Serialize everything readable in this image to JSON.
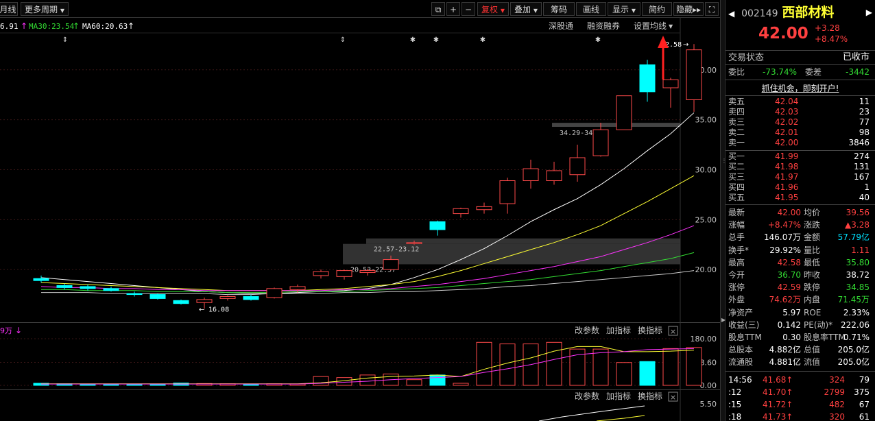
{
  "toolbar": {
    "left_tabs": [
      "月线",
      "更多周期"
    ],
    "right_buttons": [
      "复权",
      "叠加",
      "筹码",
      "画线",
      "显示",
      "简约",
      "隐藏"
    ],
    "icons": [
      "square-icon",
      "plus-icon",
      "minus-icon",
      "double-right-icon",
      "fullscreen-icon"
    ]
  },
  "ma_legend": {
    "ma_prev": "6.91",
    "ma30": "MA30:23.54",
    "ma60": "MA60:20.63"
  },
  "chart_links": {
    "shenguo": "深股通",
    "rongzi": "融资融券",
    "settings": "设置均线"
  },
  "annotations": {
    "high_label": "42.58",
    "low_label": "16.08",
    "zone1": "34.29-34.69",
    "zone2": "22.57-23.12",
    "zone3": "20.53-22.57"
  },
  "y_axis_ticks": [
    "40.00",
    "35.00",
    "30.00",
    "25.00",
    "20.00"
  ],
  "sub_panel": {
    "label": "9万",
    "buttons": [
      "改参数",
      "加指标",
      "换指标"
    ],
    "ticks": [
      "180.00",
      "88.60",
      "0.00"
    ]
  },
  "ind_panel": {
    "buttons": [
      "改参数",
      "加指标",
      "换指标"
    ],
    "ticks": [
      "5.50"
    ]
  },
  "chart_data": {
    "type": "candlestick",
    "ylim": [
      15,
      42.8
    ],
    "candles": [
      {
        "o": 19.1,
        "h": 19.4,
        "l": 18.7,
        "c": 18.9
      },
      {
        "o": 18.4,
        "h": 18.6,
        "l": 18.0,
        "c": 18.2
      },
      {
        "o": 18.3,
        "h": 18.5,
        "l": 17.9,
        "c": 18.1
      },
      {
        "o": 18.1,
        "h": 18.3,
        "l": 17.8,
        "c": 17.9
      },
      {
        "o": 17.6,
        "h": 17.8,
        "l": 17.3,
        "c": 17.5
      },
      {
        "o": 17.5,
        "h": 17.6,
        "l": 17.0,
        "c": 17.1
      },
      {
        "o": 16.9,
        "h": 17.0,
        "l": 16.5,
        "c": 16.6
      },
      {
        "o": 16.7,
        "h": 17.2,
        "l": 16.08,
        "c": 17.0
      },
      {
        "o": 17.1,
        "h": 17.4,
        "l": 16.9,
        "c": 17.3
      },
      {
        "o": 17.3,
        "h": 17.5,
        "l": 16.9,
        "c": 17.0
      },
      {
        "o": 17.2,
        "h": 18.2,
        "l": 17.1,
        "c": 18.1
      },
      {
        "o": 18.0,
        "h": 18.5,
        "l": 17.7,
        "c": 18.3
      },
      {
        "o": 19.4,
        "h": 20.0,
        "l": 19.1,
        "c": 19.8
      },
      {
        "o": 19.3,
        "h": 20.0,
        "l": 19.0,
        "c": 19.9
      },
      {
        "o": 19.7,
        "h": 20.1,
        "l": 19.4,
        "c": 19.9
      },
      {
        "o": 20.0,
        "h": 21.4,
        "l": 19.9,
        "c": 21.0
      },
      {
        "o": 22.6,
        "h": 22.9,
        "l": 22.5,
        "c": 22.7
      },
      {
        "o": 24.8,
        "h": 24.9,
        "l": 23.4,
        "c": 24.0
      },
      {
        "o": 25.6,
        "h": 26.2,
        "l": 25.2,
        "c": 26.1
      },
      {
        "o": 26.0,
        "h": 26.7,
        "l": 25.6,
        "c": 26.3
      },
      {
        "o": 26.6,
        "h": 29.2,
        "l": 25.6,
        "c": 28.9
      },
      {
        "o": 28.9,
        "h": 31.0,
        "l": 28.1,
        "c": 30.1
      },
      {
        "o": 28.9,
        "h": 30.8,
        "l": 28.5,
        "c": 29.9
      },
      {
        "o": 29.5,
        "h": 32.5,
        "l": 28.8,
        "c": 31.2
      },
      {
        "o": 31.4,
        "h": 34.7,
        "l": 31.3,
        "c": 34.0
      },
      {
        "o": 34.0,
        "h": 37.4,
        "l": 34.0,
        "c": 37.4
      },
      {
        "o": 40.5,
        "h": 41.0,
        "l": 36.8,
        "c": 37.8
      },
      {
        "o": 38.2,
        "h": 39.2,
        "l": 36.2,
        "c": 39.0
      },
      {
        "o": 37.0,
        "h": 42.58,
        "l": 35.8,
        "c": 42.0
      }
    ],
    "ma_lines": [
      {
        "name": "MA-white",
        "color": "#ffffff",
        "values": [
          19.2,
          19.0,
          18.8,
          18.6,
          18.4,
          18.2,
          18.0,
          17.8,
          17.7,
          17.6,
          17.6,
          17.7,
          17.8,
          17.9,
          18.1,
          18.5,
          19.2,
          20.0,
          21.0,
          22.1,
          23.4,
          24.8,
          26.0,
          27.1,
          28.5,
          30.1,
          31.9,
          33.6,
          35.7
        ]
      },
      {
        "name": "MA-yellow",
        "color": "#ffff33",
        "values": [
          18.7,
          18.6,
          18.5,
          18.4,
          18.3,
          18.2,
          18.1,
          18.0,
          17.9,
          17.9,
          17.9,
          17.9,
          18.0,
          18.1,
          18.3,
          18.5,
          18.8,
          19.3,
          19.9,
          20.6,
          21.3,
          22.0,
          22.7,
          23.5,
          24.4,
          25.6,
          26.8,
          28.1,
          29.4
        ]
      },
      {
        "name": "MA-magenta",
        "color": "#ff33ff",
        "values": [
          18.3,
          18.2,
          18.2,
          18.1,
          18.1,
          18.0,
          18.0,
          17.9,
          17.9,
          17.9,
          17.9,
          17.9,
          17.9,
          18.0,
          18.0,
          18.1,
          18.3,
          18.5,
          18.8,
          19.1,
          19.5,
          19.9,
          20.3,
          20.8,
          21.3,
          22.0,
          22.7,
          23.5,
          24.4
        ]
      },
      {
        "name": "MA30",
        "color": "#33dd33",
        "values": [
          18.0,
          18.0,
          17.9,
          17.9,
          17.9,
          17.8,
          17.8,
          17.8,
          17.7,
          17.7,
          17.7,
          17.8,
          17.8,
          17.8,
          17.9,
          18.0,
          18.1,
          18.2,
          18.4,
          18.6,
          18.8,
          19.0,
          19.3,
          19.6,
          19.9,
          20.3,
          20.7,
          21.1,
          21.7
        ]
      },
      {
        "name": "MA60",
        "color": "#cccccc",
        "values": [
          17.7,
          17.7,
          17.7,
          17.6,
          17.6,
          17.6,
          17.6,
          17.6,
          17.5,
          17.5,
          17.6,
          17.6,
          17.6,
          17.7,
          17.7,
          17.8,
          17.8,
          17.9,
          18.0,
          18.1,
          18.3,
          18.4,
          18.6,
          18.8,
          19.0,
          19.2,
          19.4,
          19.6,
          19.9
        ]
      }
    ],
    "zones": [
      {
        "low": 34.29,
        "high": 34.69
      },
      {
        "low": 22.57,
        "high": 23.12
      },
      {
        "low": 20.53,
        "high": 22.57
      }
    ],
    "volume": {
      "ylim": [
        0,
        180
      ],
      "values": [
        8,
        6,
        5,
        5,
        4,
        5,
        9,
        7,
        6,
        5,
        6,
        5,
        34,
        30,
        40,
        44,
        22,
        40,
        8,
        166,
        160,
        160,
        166,
        140,
        140,
        88,
        92,
        142,
        146
      ],
      "ma_a": [
        6,
        6,
        6,
        6,
        6,
        6,
        6,
        6,
        6,
        6,
        6,
        6,
        10,
        18,
        28,
        34,
        36,
        40,
        34,
        62,
        86,
        106,
        132,
        150,
        150,
        130,
        130,
        132,
        136
      ],
      "ma_b": [
        5,
        5,
        5,
        5,
        5,
        5,
        5,
        5,
        5,
        5,
        5,
        5,
        8,
        12,
        16,
        22,
        26,
        30,
        34,
        50,
        64,
        80,
        100,
        118,
        126,
        130,
        138,
        140,
        142
      ]
    }
  },
  "panel": {
    "code": "002149",
    "name": "西部材料",
    "price": "42.00",
    "change": "+3.28",
    "change_pct": "+8.47%",
    "trade_status_label": "交易状态",
    "trade_status_value": "已收市",
    "weibi_label": "委比",
    "weibi_value": "-73.74%",
    "weicha_label": "委差",
    "weicha_value": "-3442",
    "promo": "抓住机会，即刻开户!",
    "asks": [
      {
        "label": "卖五",
        "price": "42.04",
        "vol": "11"
      },
      {
        "label": "卖四",
        "price": "42.03",
        "vol": "23"
      },
      {
        "label": "卖三",
        "price": "42.02",
        "vol": "77"
      },
      {
        "label": "卖二",
        "price": "42.01",
        "vol": "98"
      },
      {
        "label": "卖一",
        "price": "42.00",
        "vol": "3846"
      }
    ],
    "bids": [
      {
        "label": "买一",
        "price": "41.99",
        "vol": "274"
      },
      {
        "label": "买二",
        "price": "41.98",
        "vol": "131"
      },
      {
        "label": "买三",
        "price": "41.97",
        "vol": "167"
      },
      {
        "label": "买四",
        "price": "41.96",
        "vol": "1"
      },
      {
        "label": "买五",
        "price": "41.95",
        "vol": "40"
      }
    ],
    "stats": [
      {
        "l1": "最新",
        "v1": "42.00",
        "c1": "up",
        "l2": "均价",
        "v2": "39.56",
        "c2": "up"
      },
      {
        "l1": "涨幅",
        "v1": "+8.47%",
        "c1": "up",
        "l2": "涨跌",
        "v2": "▲3.28",
        "c2": "up"
      },
      {
        "l1": "总手",
        "v1": "146.07万",
        "c1": "wht",
        "l2": "金额",
        "v2": "57.79亿",
        "c2": "cyn"
      },
      {
        "l1": "换手*",
        "v1": "29.92%",
        "c1": "wht",
        "l2": "量比",
        "v2": "1.11",
        "c2": "up"
      },
      {
        "l1": "最高",
        "v1": "42.58",
        "c1": "up",
        "l2": "最低",
        "v2": "35.80",
        "c2": "dn"
      },
      {
        "l1": "今开",
        "v1": "36.70",
        "c1": "dn",
        "l2": "昨收",
        "v2": "38.72",
        "c2": "wht"
      },
      {
        "l1": "涨停",
        "v1": "42.59",
        "c1": "up",
        "l2": "跌停",
        "v2": "34.85",
        "c2": "dn"
      },
      {
        "l1": "外盘",
        "v1": "74.62万",
        "c1": "up",
        "l2": "内盘",
        "v2": "71.45万",
        "c2": "dn"
      },
      {
        "l1": "净资产",
        "v1": "5.97",
        "c1": "wht",
        "l2": "ROE",
        "v2": "2.33%",
        "c2": "wht"
      },
      {
        "l1": "收益(三)",
        "v1": "0.142",
        "c1": "wht",
        "l2": "PE(动)*",
        "v2": "222.06",
        "c2": "wht"
      },
      {
        "l1": "股息TTM",
        "v1": "0.30",
        "c1": "wht",
        "l2": "股息率TTM",
        "v2": "0.71%",
        "c2": "wht"
      },
      {
        "l1": "总股本",
        "v1": "4.882亿",
        "c1": "wht",
        "l2": "总值",
        "v2": "205.0亿",
        "c2": "wht"
      },
      {
        "l1": "流通股",
        "v1": "4.881亿",
        "c1": "wht",
        "l2": "流值",
        "v2": "205.0亿",
        "c2": "wht"
      }
    ],
    "ticks": [
      {
        "time": "14:56",
        "price": "41.68",
        "vol": "324",
        "num": "79"
      },
      {
        "time": ":12",
        "price": "41.70",
        "vol": "2799",
        "num": "375"
      },
      {
        "time": ":15",
        "price": "41.72",
        "vol": "482",
        "num": "67"
      },
      {
        "time": ":18",
        "price": "41.73",
        "vol": "320",
        "num": "61"
      }
    ]
  }
}
